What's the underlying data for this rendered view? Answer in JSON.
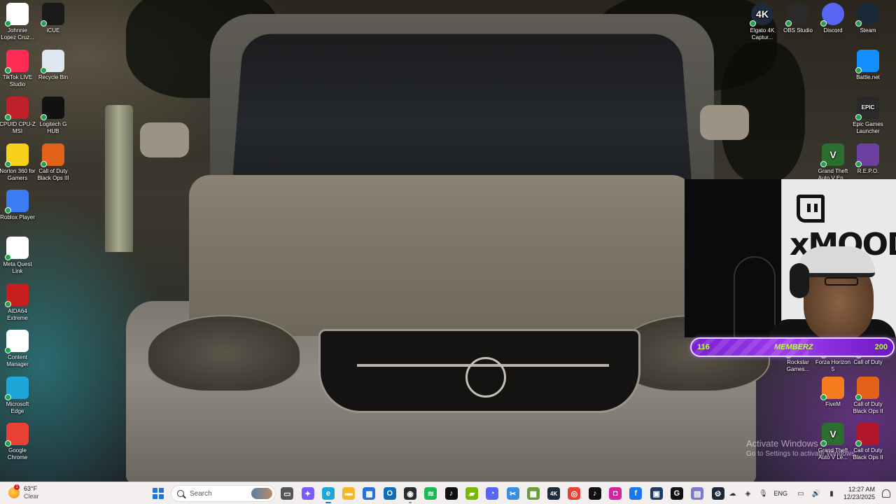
{
  "desktop": {
    "left_column": [
      {
        "label": "Johnnie Lopez Cruz...",
        "icon": "document-icon",
        "color": "#ffffff"
      },
      {
        "label": "TikTok LIVE Studio",
        "icon": "tiktok-live-icon",
        "color": "#fe2c55"
      },
      {
        "label": "CPUID CPU-Z MSI",
        "icon": "cpuz-icon",
        "color": "#c0202a"
      },
      {
        "label": "Norton 360 for Gamers",
        "icon": "norton-icon",
        "color": "#f7d11a"
      },
      {
        "label": "Roblox Player",
        "icon": "roblox-icon",
        "color": "#3b7cf2"
      },
      {
        "label": "Meta Quest Link",
        "icon": "meta-icon",
        "color": "#ffffff"
      },
      {
        "label": "AIDA64 Extreme",
        "icon": "aida64-icon",
        "color": "#c81d1d"
      },
      {
        "label": "Content Manager",
        "icon": "content-manager-icon",
        "color": "#ffffff"
      },
      {
        "label": "Microsoft Edge",
        "icon": "edge-icon",
        "color": "#1fa6d9"
      },
      {
        "label": "Google Chrome",
        "icon": "chrome-icon",
        "color": "#e94235"
      }
    ],
    "second_column": [
      {
        "label": "iCUE",
        "icon": "icue-icon",
        "color": "#1a1a1a"
      },
      {
        "label": "Recycle Bin",
        "icon": "recycle-bin-icon",
        "color": "#dfe8f0"
      },
      {
        "label": "Logitech G HUB",
        "icon": "logitech-g-icon",
        "color": "#111111"
      },
      {
        "label": "Call of Duty Black Ops III",
        "icon": "cod-bo3-icon",
        "color": "#e2621a"
      }
    ],
    "top_right": [
      {
        "label": "Elgato 4K Captur...",
        "icon": "elgato-4k-icon",
        "color": "#1d2b3a",
        "glyph": "4K"
      },
      {
        "label": "OBS Studio",
        "icon": "obs-icon",
        "color": "#2b2b2b"
      },
      {
        "label": "Discord",
        "icon": "discord-icon",
        "color": "#5865f2"
      },
      {
        "label": "Steam",
        "icon": "steam-icon",
        "color": "#1b2838"
      }
    ],
    "right_column_upper": [
      {
        "label": "Battle.net",
        "icon": "battlenet-icon",
        "color": "#148eff"
      },
      {
        "label": "Epic Games Launcher",
        "icon": "epic-games-icon",
        "color": "#2a2a2a",
        "glyph": "EPIC"
      },
      {
        "label": "R.E.P.O.",
        "icon": "repo-icon",
        "color": "#6b3fa0"
      }
    ],
    "gta_top": {
      "label": "Grand Theft Auto V En...",
      "icon": "gta-v-icon",
      "color": "#2c6e2f",
      "glyph": "V"
    },
    "right_column_lower": [
      {
        "label": "Rockstar Games...",
        "icon": "rockstar-icon",
        "color": "#f3b300"
      },
      {
        "label": "Forza Horizon 5",
        "icon": "forza-icon",
        "color": "#d6336c"
      },
      {
        "label": "Call of Duty",
        "icon": "cod-icon",
        "color": "#1a1a1a"
      },
      {
        "label": "FiveM",
        "icon": "fivem-icon",
        "color": "#f57c1f"
      },
      {
        "label": "Call of Duty Black Ops II",
        "icon": "cod-bo2-icon",
        "color": "#e2621a"
      },
      {
        "label": "Grand Theft Auto V Le...",
        "icon": "gta-v-legacy-icon",
        "color": "#2c6e2f",
        "glyph": "V"
      },
      {
        "label": "Call of Duty Black Ops II",
        "icon": "cod-bo2-icon",
        "color": "#b0182a"
      }
    ]
  },
  "stream_overlay": {
    "sign_text": "xMOOD",
    "member_count": "116",
    "member_title": "MEMBERZ",
    "member_goal": "200",
    "progress_fraction": 0.58
  },
  "watermark": {
    "line1": "Activate Windows",
    "line2": "Go to Settings to activate Windows."
  },
  "taskbar": {
    "weather_temp": "63°F",
    "weather_cond": "Clear",
    "weather_badge": "1",
    "search_placeholder": "Search",
    "apps": [
      {
        "name": "task-view",
        "color": "#555555",
        "glyph": "▭"
      },
      {
        "name": "copilot",
        "color": "#7b5cf5",
        "glyph": "✦"
      },
      {
        "name": "edge",
        "color": "#1fa6d9",
        "glyph": "e",
        "state": "active"
      },
      {
        "name": "file-explorer",
        "color": "#f2b72b",
        "glyph": "▬"
      },
      {
        "name": "microsoft-store",
        "color": "#2a6fd6",
        "glyph": "▦"
      },
      {
        "name": "outlook",
        "color": "#0f6cbd",
        "glyph": "O"
      },
      {
        "name": "obs",
        "color": "#2b2b2b",
        "glyph": "◉",
        "state": "open"
      },
      {
        "name": "spotify",
        "color": "#1db954",
        "glyph": "≋"
      },
      {
        "name": "tiktok",
        "color": "#111111",
        "glyph": "♪"
      },
      {
        "name": "nvidia",
        "color": "#76b900",
        "glyph": "▰"
      },
      {
        "name": "discord",
        "color": "#5865f2",
        "glyph": "◔"
      },
      {
        "name": "snipping-tool",
        "color": "#3a8de0",
        "glyph": "✂"
      },
      {
        "name": "minecraft",
        "color": "#6a9a3a",
        "glyph": "▩"
      },
      {
        "name": "elgato-4k",
        "color": "#1d2b3a",
        "glyph": "4K"
      },
      {
        "name": "chrome",
        "color": "#e94235",
        "glyph": "◎"
      },
      {
        "name": "tiktok-studio",
        "color": "#111111",
        "glyph": "♪"
      },
      {
        "name": "instagram",
        "color": "#d6249f",
        "glyph": "◘"
      },
      {
        "name": "facebook",
        "color": "#1877f2",
        "glyph": "f"
      },
      {
        "name": "elgato-stream",
        "color": "#1e3a5f",
        "glyph": "▣"
      },
      {
        "name": "logitech-g",
        "color": "#111111",
        "glyph": "G"
      },
      {
        "name": "notepad",
        "color": "#7a7ad0",
        "glyph": "▤"
      },
      {
        "name": "steam",
        "color": "#1b2838",
        "glyph": "⚙"
      }
    ],
    "lang": "ENG",
    "time": "12:27 AM",
    "date": "12/23/2025"
  }
}
